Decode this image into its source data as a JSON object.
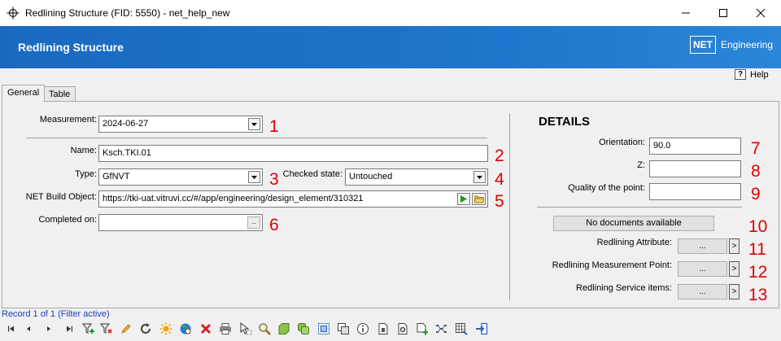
{
  "window": {
    "title": "Redlining Structure (FID: 5550) - net_help_new"
  },
  "banner": {
    "title": "Redlining Structure",
    "brand_net": "NET",
    "brand_eng": "Engineering"
  },
  "help": {
    "label": "Help",
    "icon_glyph": "?"
  },
  "tabs": [
    {
      "label": "General"
    },
    {
      "label": "Table"
    }
  ],
  "form": {
    "measurement": {
      "label": "Measurement:",
      "value": "2024-06-27"
    },
    "name": {
      "label": "Name:",
      "value": "Ksch.TKI.01"
    },
    "type": {
      "label": "Type:",
      "value": "GfNVT"
    },
    "checked_state": {
      "label": "Checked state:",
      "value": "Untouched"
    },
    "net_build_object": {
      "label": "NET Build Object:",
      "value": "https://tki-uat.vitruvi.cc/#/app/engineering/design_element/310321"
    },
    "completed_on": {
      "label": "Completed on:",
      "value": ""
    },
    "ellipsis": ".."
  },
  "details": {
    "title": "DETAILS",
    "orientation": {
      "label": "Orientation:",
      "value": "90.0"
    },
    "z": {
      "label": "Z:",
      "value": ""
    },
    "quality": {
      "label": "Quality of the point:",
      "value": ""
    },
    "no_documents": "No documents available",
    "redlining_attribute": {
      "label": "Redlining Attribute:",
      "button": "...",
      "arrow": ">"
    },
    "redlining_measurement_point": {
      "label": "Redlining Measurement Point:",
      "button": "...",
      "arrow": ">"
    },
    "redlining_service_items": {
      "label": "Redlining Service items:",
      "button": "...",
      "arrow": ">"
    }
  },
  "annotations": [
    "1",
    "2",
    "3",
    "4",
    "5",
    "6",
    "7",
    "8",
    "9",
    "10",
    "11",
    "12",
    "13"
  ],
  "status": {
    "record": "Record 1 of 1 (Filter active)"
  },
  "colors": {
    "banner": "#1f74cc",
    "annotation": "#e00000",
    "status": "#1a3fb5"
  },
  "toolbar_icons": [
    "first-record-icon",
    "previous-record-icon",
    "next-record-icon",
    "last-record-icon",
    "add-filter-icon",
    "remove-filter-icon",
    "edit-icon",
    "refresh-icon",
    "highlight-icon",
    "zoom-to-icon",
    "delete-icon",
    "print-icon",
    "select-icon",
    "search-icon",
    "shape-icon",
    "copy-icon",
    "frame-icon",
    "duplicate-icon",
    "info-icon",
    "document-icon",
    "document-settings-icon",
    "add-document-icon",
    "flow-icon",
    "table-export-icon",
    "exit-icon"
  ]
}
